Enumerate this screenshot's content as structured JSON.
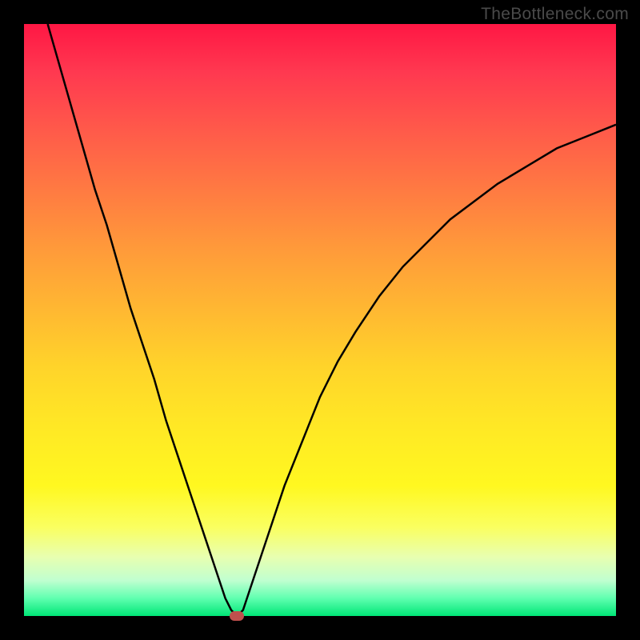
{
  "attribution": "TheBottleneck.com",
  "chart_data": {
    "type": "line",
    "title": "",
    "xlabel": "",
    "ylabel": "",
    "xlim": [
      0,
      100
    ],
    "ylim": [
      0,
      100
    ],
    "series": [
      {
        "name": "bottleneck-curve",
        "x": [
          4,
          6,
          8,
          10,
          12,
          14,
          16,
          18,
          20,
          22,
          24,
          26,
          28,
          30,
          32,
          33,
          34,
          35,
          36,
          37,
          38,
          40,
          42,
          44,
          46,
          48,
          50,
          53,
          56,
          60,
          64,
          68,
          72,
          76,
          80,
          85,
          90,
          95,
          100
        ],
        "values": [
          100,
          93,
          86,
          79,
          72,
          66,
          59,
          52,
          46,
          40,
          33,
          27,
          21,
          15,
          9,
          6,
          3,
          1,
          0,
          1,
          4,
          10,
          16,
          22,
          27,
          32,
          37,
          43,
          48,
          54,
          59,
          63,
          67,
          70,
          73,
          76,
          79,
          81,
          83
        ]
      }
    ],
    "marker": {
      "x": 36,
      "y": 0
    },
    "gradient_stops": [
      {
        "pos": 0,
        "color": "#ff1744"
      },
      {
        "pos": 50,
        "color": "#ffd42a"
      },
      {
        "pos": 100,
        "color": "#00e676"
      }
    ]
  }
}
